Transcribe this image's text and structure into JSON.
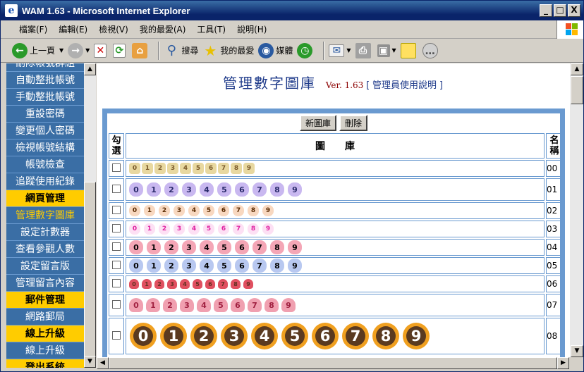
{
  "window": {
    "title": "WAM 1.63 - Microsoft Internet Explorer",
    "min": "_",
    "max": "□",
    "close": "X"
  },
  "menu": [
    "檔案(F)",
    "編輯(E)",
    "檢視(V)",
    "我的最愛(A)",
    "工具(T)",
    "說明(H)"
  ],
  "toolbar": {
    "back": "上一頁",
    "search": "搜尋",
    "favorites": "我的最愛",
    "media": "媒體"
  },
  "sidebar": {
    "items": [
      {
        "label": "刪除帳號群組",
        "type": "link"
      },
      {
        "label": "自動整批帳號",
        "type": "link"
      },
      {
        "label": "手動整批帳號",
        "type": "link"
      },
      {
        "label": "重設密碼",
        "type": "link"
      },
      {
        "label": "變更個人密碼",
        "type": "link"
      },
      {
        "label": "檢視帳號結構",
        "type": "link"
      },
      {
        "label": "帳號檢查",
        "type": "link"
      },
      {
        "label": "追蹤使用紀錄",
        "type": "link"
      },
      {
        "label": "網頁管理",
        "type": "section"
      },
      {
        "label": "管理數字圖庫",
        "type": "current"
      },
      {
        "label": "設定計數器",
        "type": "link"
      },
      {
        "label": "查看參觀人數",
        "type": "link"
      },
      {
        "label": "設定留言版",
        "type": "link"
      },
      {
        "label": "管理留言內容",
        "type": "link"
      },
      {
        "label": "郵件管理",
        "type": "section"
      },
      {
        "label": "網路郵局",
        "type": "link"
      },
      {
        "label": "線上升級",
        "type": "section"
      },
      {
        "label": "線上升級",
        "type": "link"
      },
      {
        "label": "登出系統",
        "type": "section"
      }
    ]
  },
  "page": {
    "title": "管理數字圖庫",
    "version": "Ver. 1.63",
    "help_open": "[",
    "help_link": "管理員使用說明",
    "help_close": "]",
    "new_button": "新圖庫",
    "delete_button": "刪除",
    "col_check": "勾選",
    "col_gallery": "圖　　庫",
    "col_name": "名稱"
  },
  "digits": [
    "0",
    "1",
    "2",
    "3",
    "4",
    "5",
    "6",
    "7",
    "8",
    "9"
  ],
  "galleries": [
    {
      "name": "00",
      "style": "blocks",
      "color": "#7a5a2a",
      "bg": "#e8d8a0",
      "size": 16,
      "shape": "round"
    },
    {
      "name": "01",
      "style": "flowers",
      "color": "#2a2a6a",
      "bg": "#c9b8f0",
      "size": 20,
      "shape": "flower"
    },
    {
      "name": "02",
      "style": "dots",
      "color": "#5a2a00",
      "bg": "#f8d8c0",
      "size": 16,
      "shape": "flower"
    },
    {
      "name": "03",
      "style": "pink",
      "color": "#e020a0",
      "bg": "#fde0f4",
      "size": 16,
      "shape": "flower"
    },
    {
      "name": "04",
      "style": "pinkflower",
      "color": "#000",
      "bg": "#f4a6b6",
      "size": 20,
      "shape": "flower"
    },
    {
      "name": "05",
      "style": "blueflower",
      "color": "#000",
      "bg": "#b8c8f0",
      "size": 20,
      "shape": "flower"
    },
    {
      "name": "06",
      "style": "hearts",
      "color": "#603020",
      "bg": "#e05060",
      "size": 14,
      "shape": "heart"
    },
    {
      "name": "07",
      "style": "bows",
      "color": "#a02040",
      "bg": "#f0a0b0",
      "size": 20,
      "shape": "heart"
    },
    {
      "name": "08",
      "style": "sunflower",
      "color": "#fff",
      "bg": "#f0a020",
      "size": 38,
      "shape": "sun"
    }
  ]
}
